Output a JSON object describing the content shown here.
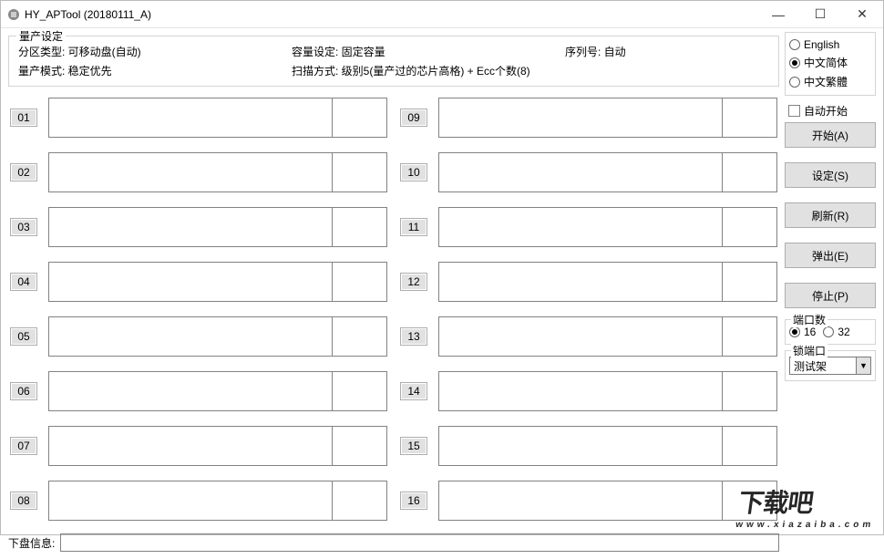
{
  "title": "HY_APTool (20180111_A)",
  "settings": {
    "legend": "量产设定",
    "partition_type": "分区类型: 可移动盘(自动)",
    "capacity": "容量设定: 固定容量",
    "serial": "序列号:  自动",
    "mode": "量产模式: 稳定优先",
    "scan": "扫描方式: 级别5(量产过的芯片高格) + Ecc个数(8)"
  },
  "slots_left": [
    "01",
    "02",
    "03",
    "04",
    "05",
    "06",
    "07",
    "08"
  ],
  "slots_right": [
    "09",
    "10",
    "11",
    "12",
    "13",
    "14",
    "15",
    "16"
  ],
  "bottom_label": "下盘信息:",
  "lang": {
    "english": "English",
    "simplified": "中文简体",
    "traditional": "中文繁體"
  },
  "auto_start": "自动开始",
  "buttons": {
    "start": "开始(A)",
    "setting": "设定(S)",
    "refresh": "刷新(R)",
    "eject": "弹出(E)",
    "stop": "停止(P)"
  },
  "port": {
    "legend": "端口数",
    "opt16": "16",
    "opt32": "32"
  },
  "lock": {
    "legend": "锁端口",
    "value": "测试架"
  },
  "watermark": {
    "main": "下载吧",
    "sub": "www.xiazaiba.com"
  }
}
